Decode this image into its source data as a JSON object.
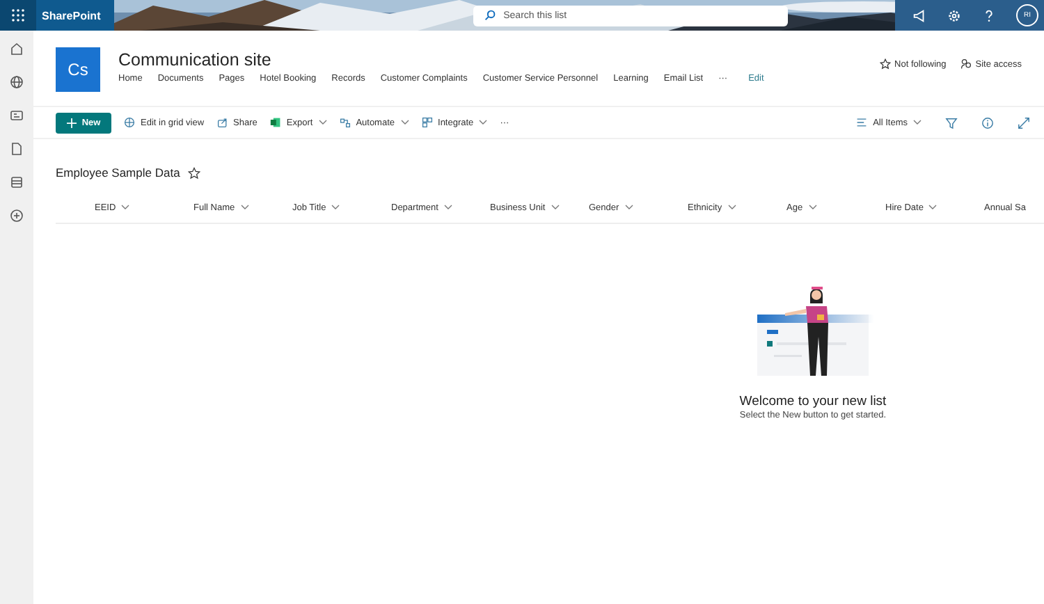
{
  "suite_bar": {
    "app_name": "SharePoint",
    "search": {
      "placeholder": "Search this list"
    },
    "avatar": {
      "initials": "RI"
    }
  },
  "site": {
    "logo": "Cs",
    "title": "Communication site",
    "nav": [
      "Home",
      "Documents",
      "Pages",
      "Hotel Booking",
      "Records",
      "Customer Complaints",
      "Customer Service Personnel",
      "Learning",
      "Email List"
    ],
    "nav_more": "···",
    "edit_link": "Edit",
    "follow": "Not following",
    "site_access": "Site access"
  },
  "command_bar": {
    "new_button": "New",
    "items": [
      {
        "label": "Edit in grid view",
        "kind": "grid",
        "dropdown": false
      },
      {
        "label": "Share",
        "kind": "share",
        "dropdown": false
      },
      {
        "label": "Export",
        "kind": "excel",
        "dropdown": true
      },
      {
        "label": "Automate",
        "kind": "flow",
        "dropdown": true
      },
      {
        "label": "Integrate",
        "kind": "apps",
        "dropdown": true
      }
    ],
    "more": "···",
    "view": "All Items"
  },
  "list": {
    "title": "Employee Sample Data",
    "favorite": false,
    "columns": [
      "EEID",
      "Full Name",
      "Job Title",
      "Department",
      "Business Unit",
      "Gender",
      "Ethnicity",
      "Age",
      "Hire Date",
      "Annual Sa"
    ]
  },
  "empty_state": {
    "title": "Welcome to your new list",
    "subtitle": "Select the New button to get started."
  }
}
